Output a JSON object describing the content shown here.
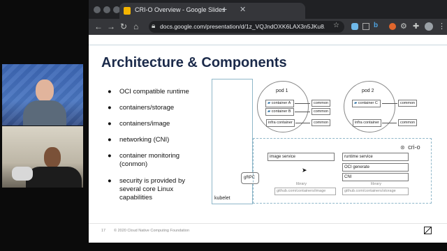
{
  "browser": {
    "tab_title": "CRI-O Overview - Google Slides",
    "url": "docs.google.com/presentation/d/1z_VQJndOXK6LAX3n5JKu8..."
  },
  "slide": {
    "title": "Architecture & Components",
    "bullets": [
      "OCI compatible runtime",
      "containers/storage",
      "containers/image",
      "networking (CNI)",
      "container monitoring (conmon)",
      "security is provided by several core Linux capabilities"
    ],
    "footer_page": "17",
    "footer_text": "© 2020 Cloud Native Computing Foundation",
    "diagram": {
      "kubelet": "kubelet",
      "grpc": "gRPC",
      "crio_logo": "cri-o",
      "pod1": {
        "label": "pod 1",
        "container_a": "container A",
        "container_b": "container B",
        "infra": "infra container"
      },
      "pod2": {
        "label": "pod 2",
        "container_c": "container C",
        "infra": "infra container"
      },
      "common": "common",
      "image_service": "image service",
      "runtime_service": "runtime service",
      "oci_generate": "OCI generate",
      "cni": "CNI",
      "library": "library",
      "lib_image": "github.com/containers/image",
      "lib_storage": "github.com/containers/storage"
    }
  },
  "colors": {
    "title": "#1b2a4a",
    "diagram_border": "#8fb7c9"
  }
}
